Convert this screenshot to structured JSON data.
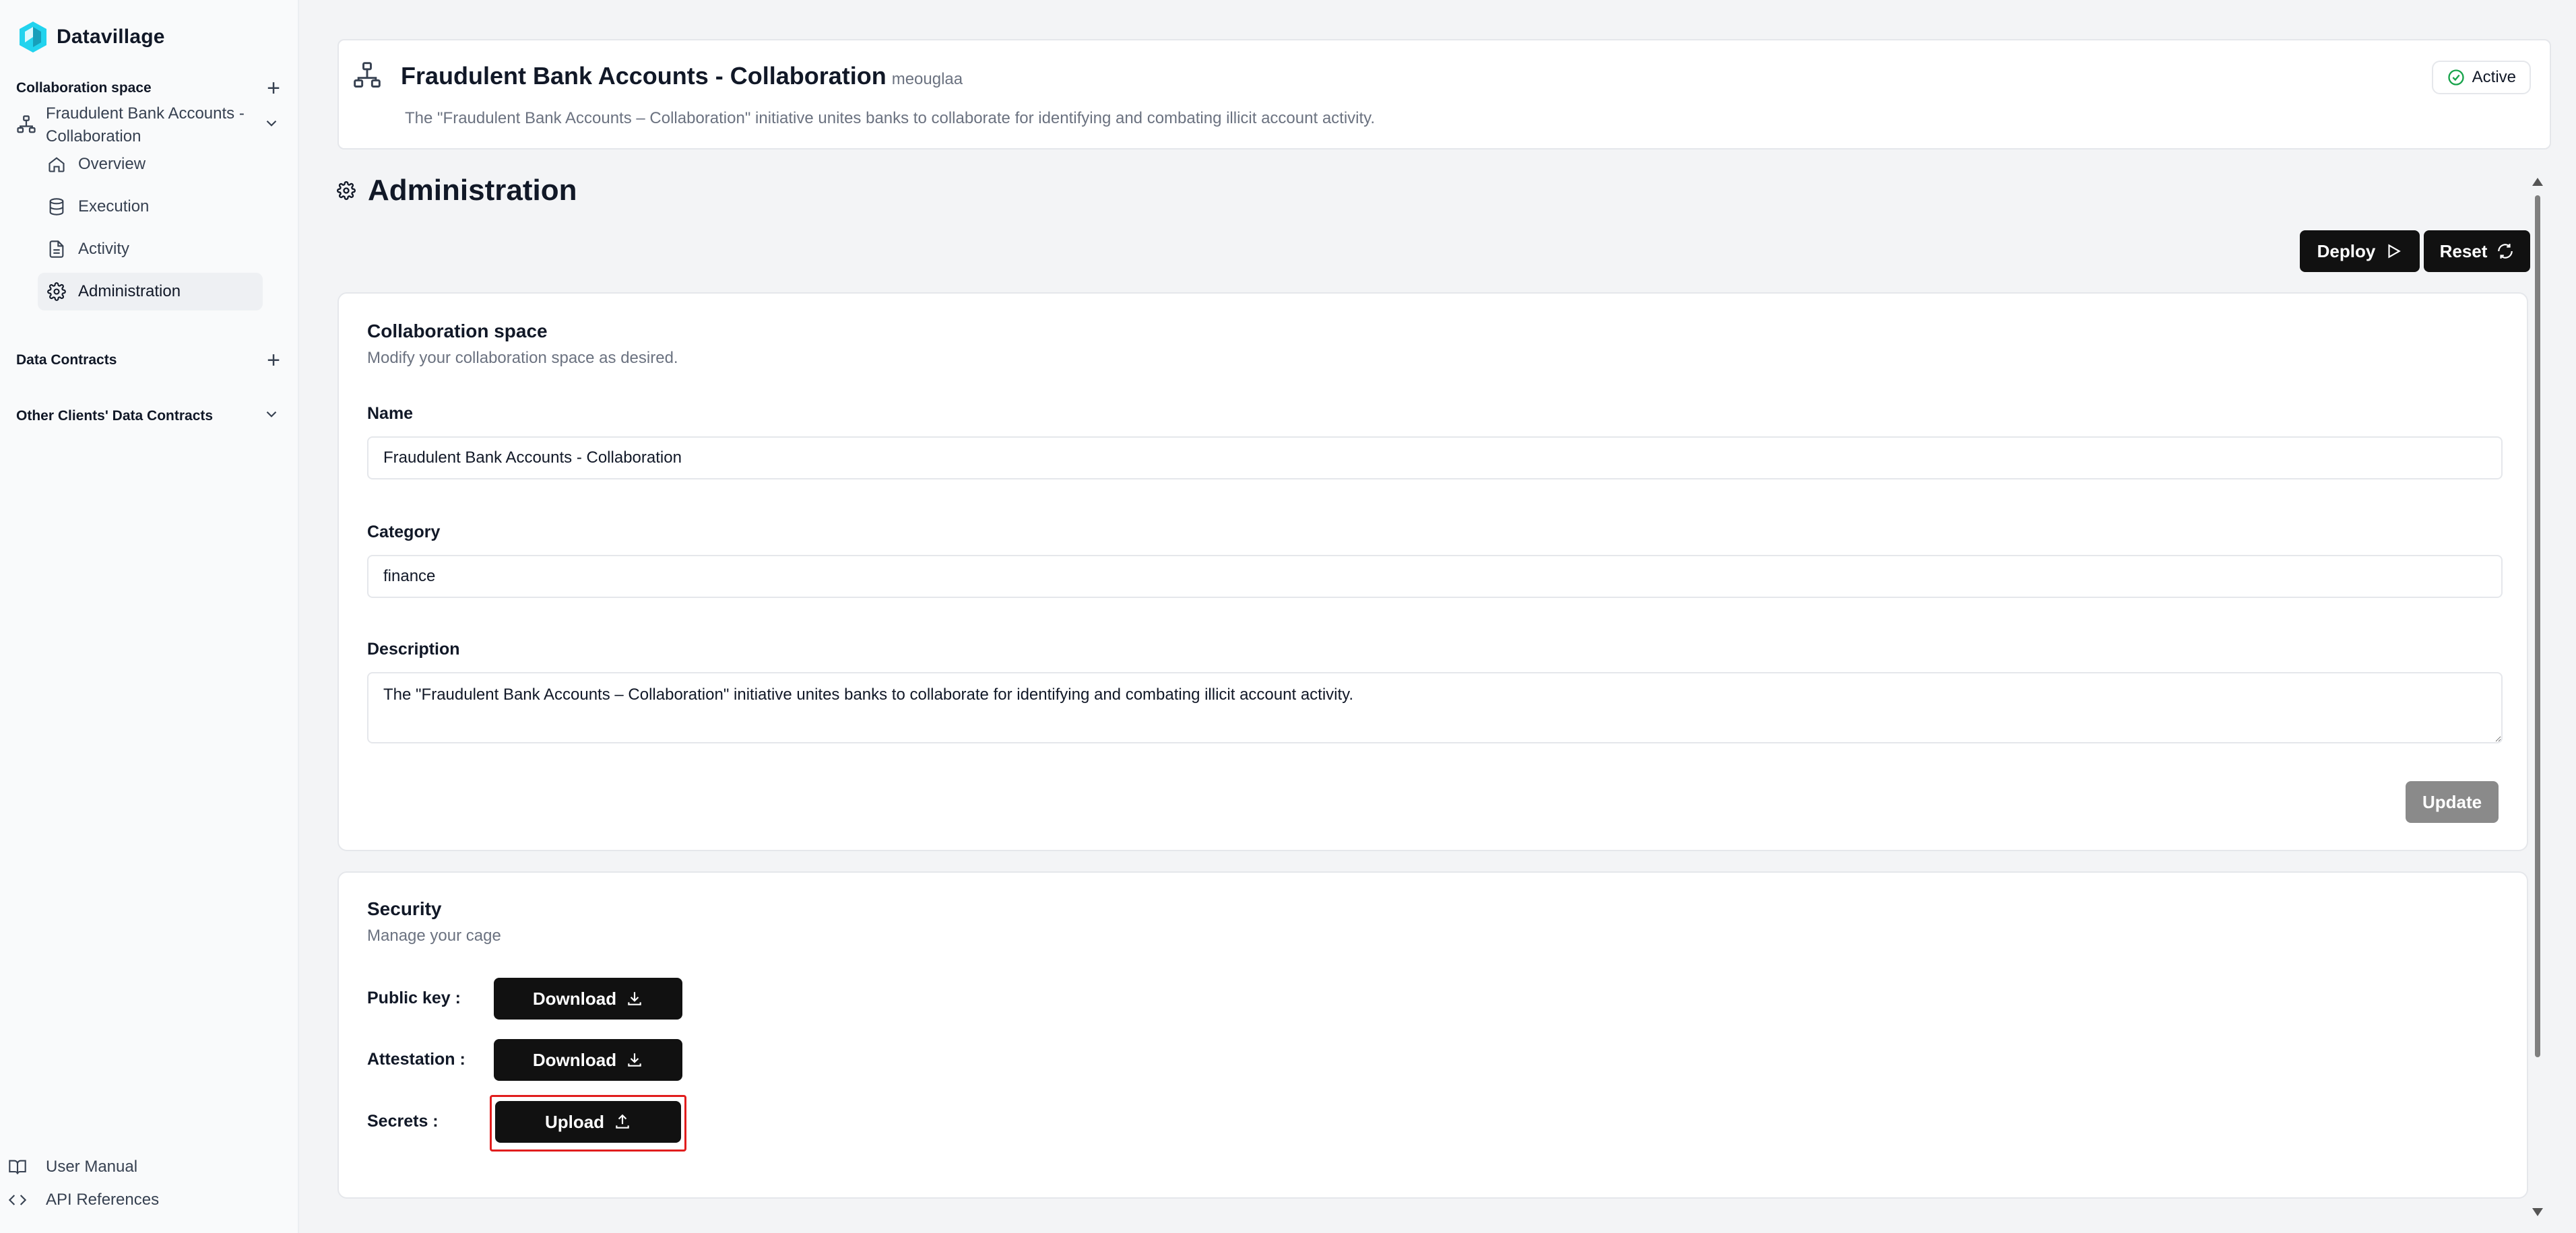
{
  "brand": {
    "name": "Datavillage",
    "color": "#22d3ee"
  },
  "sidebar": {
    "collab_section": "Collaboration space",
    "collab_item": "Fraudulent Bank Accounts - Collaboration",
    "nav": [
      {
        "label": "Overview",
        "icon": "home-icon"
      },
      {
        "label": "Execution",
        "icon": "database-icon"
      },
      {
        "label": "Activity",
        "icon": "file-icon"
      },
      {
        "label": "Administration",
        "icon": "gear-icon",
        "active": true
      }
    ],
    "data_contracts": "Data Contracts",
    "other_contracts": "Other Clients' Data Contracts",
    "user_manual": "User Manual",
    "api_references": "API References"
  },
  "header": {
    "title": "Fraudulent Bank Accounts - Collaboration",
    "user": "meouglaa",
    "description": "The \"Fraudulent Bank Accounts – Collaboration\" initiative unites banks to collaborate for identifying and combating illicit account activity.",
    "status": "Active",
    "status_color": "#16a34a"
  },
  "page": {
    "title": "Administration",
    "deploy_label": "Deploy",
    "reset_label": "Reset"
  },
  "collab_form": {
    "title": "Collaboration space",
    "subtitle": "Modify your collaboration space as desired.",
    "name_label": "Name",
    "name_value": "Fraudulent Bank Accounts - Collaboration",
    "category_label": "Category",
    "category_value": "finance",
    "description_label": "Description",
    "description_value": "The \"Fraudulent Bank Accounts – Collaboration\" initiative unites banks to collaborate for identifying and combating illicit account activity.",
    "update_label": "Update"
  },
  "security": {
    "title": "Security",
    "subtitle": "Manage your cage",
    "public_key_label": "Public key :",
    "attestation_label": "Attestation :",
    "secrets_label": "Secrets :",
    "download_label": "Download",
    "upload_label": "Upload",
    "highlight_color": "#e11d1d"
  }
}
